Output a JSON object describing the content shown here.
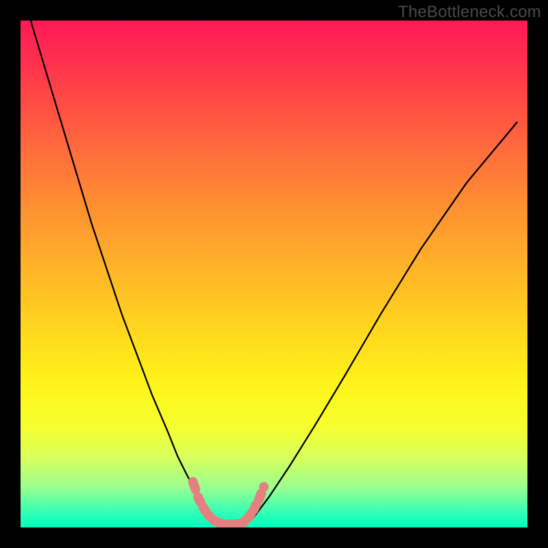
{
  "watermark_text": "TheBottleneck.com",
  "colors": {
    "frame": "#000000",
    "gradient_top": "#ff1a55",
    "gradient_bottom": "#00ffc0",
    "curve": "#000000",
    "scatter": "#e38080"
  },
  "chart_data": {
    "type": "line",
    "title": "",
    "xlabel": "",
    "ylabel": "",
    "xlim": [
      0,
      100
    ],
    "ylim": [
      0,
      100
    ],
    "series": [
      {
        "name": "left-curve",
        "x": [
          2,
          5,
          8,
          11,
          14,
          17,
          20,
          23,
          26,
          29,
          31,
          33,
          35,
          36.5,
          38,
          39.5,
          41
        ],
        "y": [
          100,
          90,
          80,
          70,
          60,
          51,
          42,
          34,
          26,
          19,
          14,
          10,
          6.5,
          4,
          2.2,
          1,
          0.5
        ]
      },
      {
        "name": "right-curve",
        "x": [
          44,
          46,
          49,
          53,
          58,
          64,
          71,
          79,
          88,
          98
        ],
        "y": [
          0.5,
          2,
          6,
          12,
          20,
          30,
          42,
          55,
          68,
          80
        ]
      }
    ],
    "scatter": {
      "name": "bottom-points",
      "points": [
        {
          "x": 34,
          "y": 9
        },
        {
          "x": 35,
          "y": 6
        },
        {
          "x": 36,
          "y": 4
        },
        {
          "x": 37,
          "y": 2.5
        },
        {
          "x": 38,
          "y": 1.5
        },
        {
          "x": 39,
          "y": 1
        },
        {
          "x": 40,
          "y": 0.7
        },
        {
          "x": 41,
          "y": 0.6
        },
        {
          "x": 42,
          "y": 0.6
        },
        {
          "x": 43,
          "y": 0.7
        },
        {
          "x": 44,
          "y": 1
        },
        {
          "x": 45,
          "y": 2
        },
        {
          "x": 46,
          "y": 3.5
        },
        {
          "x": 47,
          "y": 5.5
        },
        {
          "x": 48,
          "y": 8
        }
      ]
    }
  }
}
